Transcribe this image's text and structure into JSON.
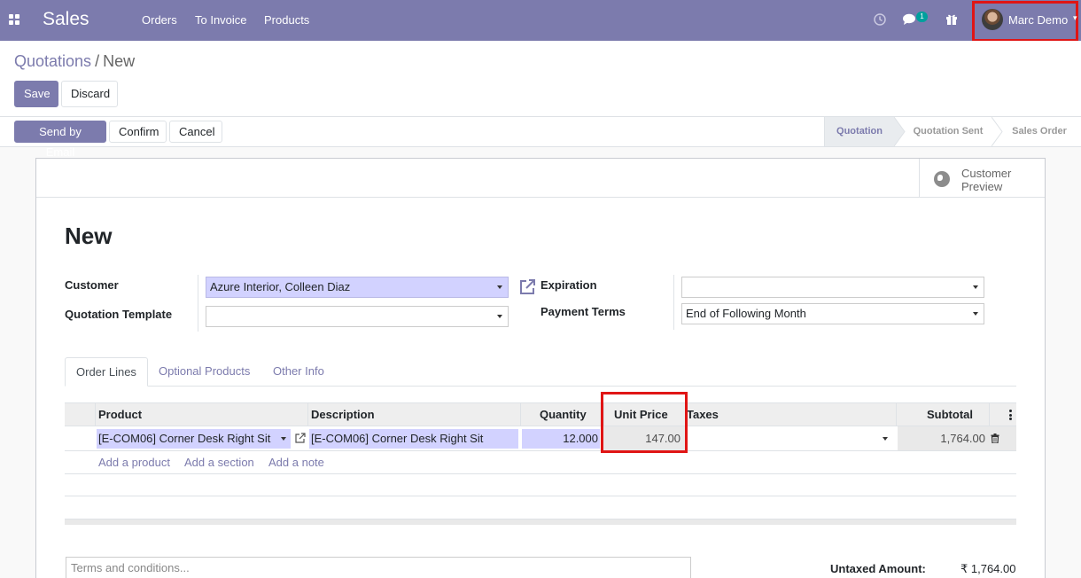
{
  "navbar": {
    "app_name": "Sales",
    "menu": [
      "Orders",
      "To Invoice",
      "Products"
    ],
    "chat_count": "1",
    "user_name": "Marc Demo",
    "bg_color": "#7c7bad"
  },
  "breadcrumb": {
    "parent": "Quotations",
    "separator": "/",
    "current": "New"
  },
  "buttons": {
    "save": "Save",
    "discard": "Discard",
    "send_email": "Send by Email",
    "confirm": "Confirm",
    "cancel": "Cancel"
  },
  "statusbar": {
    "stages": [
      "Quotation",
      "Quotation Sent",
      "Sales Order"
    ],
    "active": "Quotation"
  },
  "sheet": {
    "preview_label_1": "Customer",
    "preview_label_2": "Preview",
    "title": "New",
    "fields": {
      "customer_label": "Customer",
      "customer_value": "Azure Interior, Colleen Diaz",
      "template_label": "Quotation Template",
      "template_value": "",
      "expiration_label": "Expiration",
      "expiration_value": "",
      "payment_terms_label": "Payment Terms",
      "payment_terms_value": "End of Following Month"
    },
    "tabs": [
      "Order Lines",
      "Optional Products",
      "Other Info"
    ],
    "table": {
      "headers": [
        "Product",
        "Description",
        "Quantity",
        "Unit Price",
        "Taxes",
        "Subtotal"
      ],
      "rows": [
        {
          "product": "[E-COM06] Corner Desk Right Sit",
          "description": "[E-COM06] Corner Desk Right Sit",
          "quantity": "12.000",
          "unit_price": "147.00",
          "taxes": "",
          "subtotal": "1,764.00"
        }
      ],
      "add_links": [
        "Add a product",
        "Add a section",
        "Add a note"
      ]
    },
    "terms_placeholder": "Terms and conditions...",
    "untaxed_label": "Untaxed Amount:",
    "untaxed_value": "₹ 1,764.00"
  },
  "highlight_color": "#e01515"
}
